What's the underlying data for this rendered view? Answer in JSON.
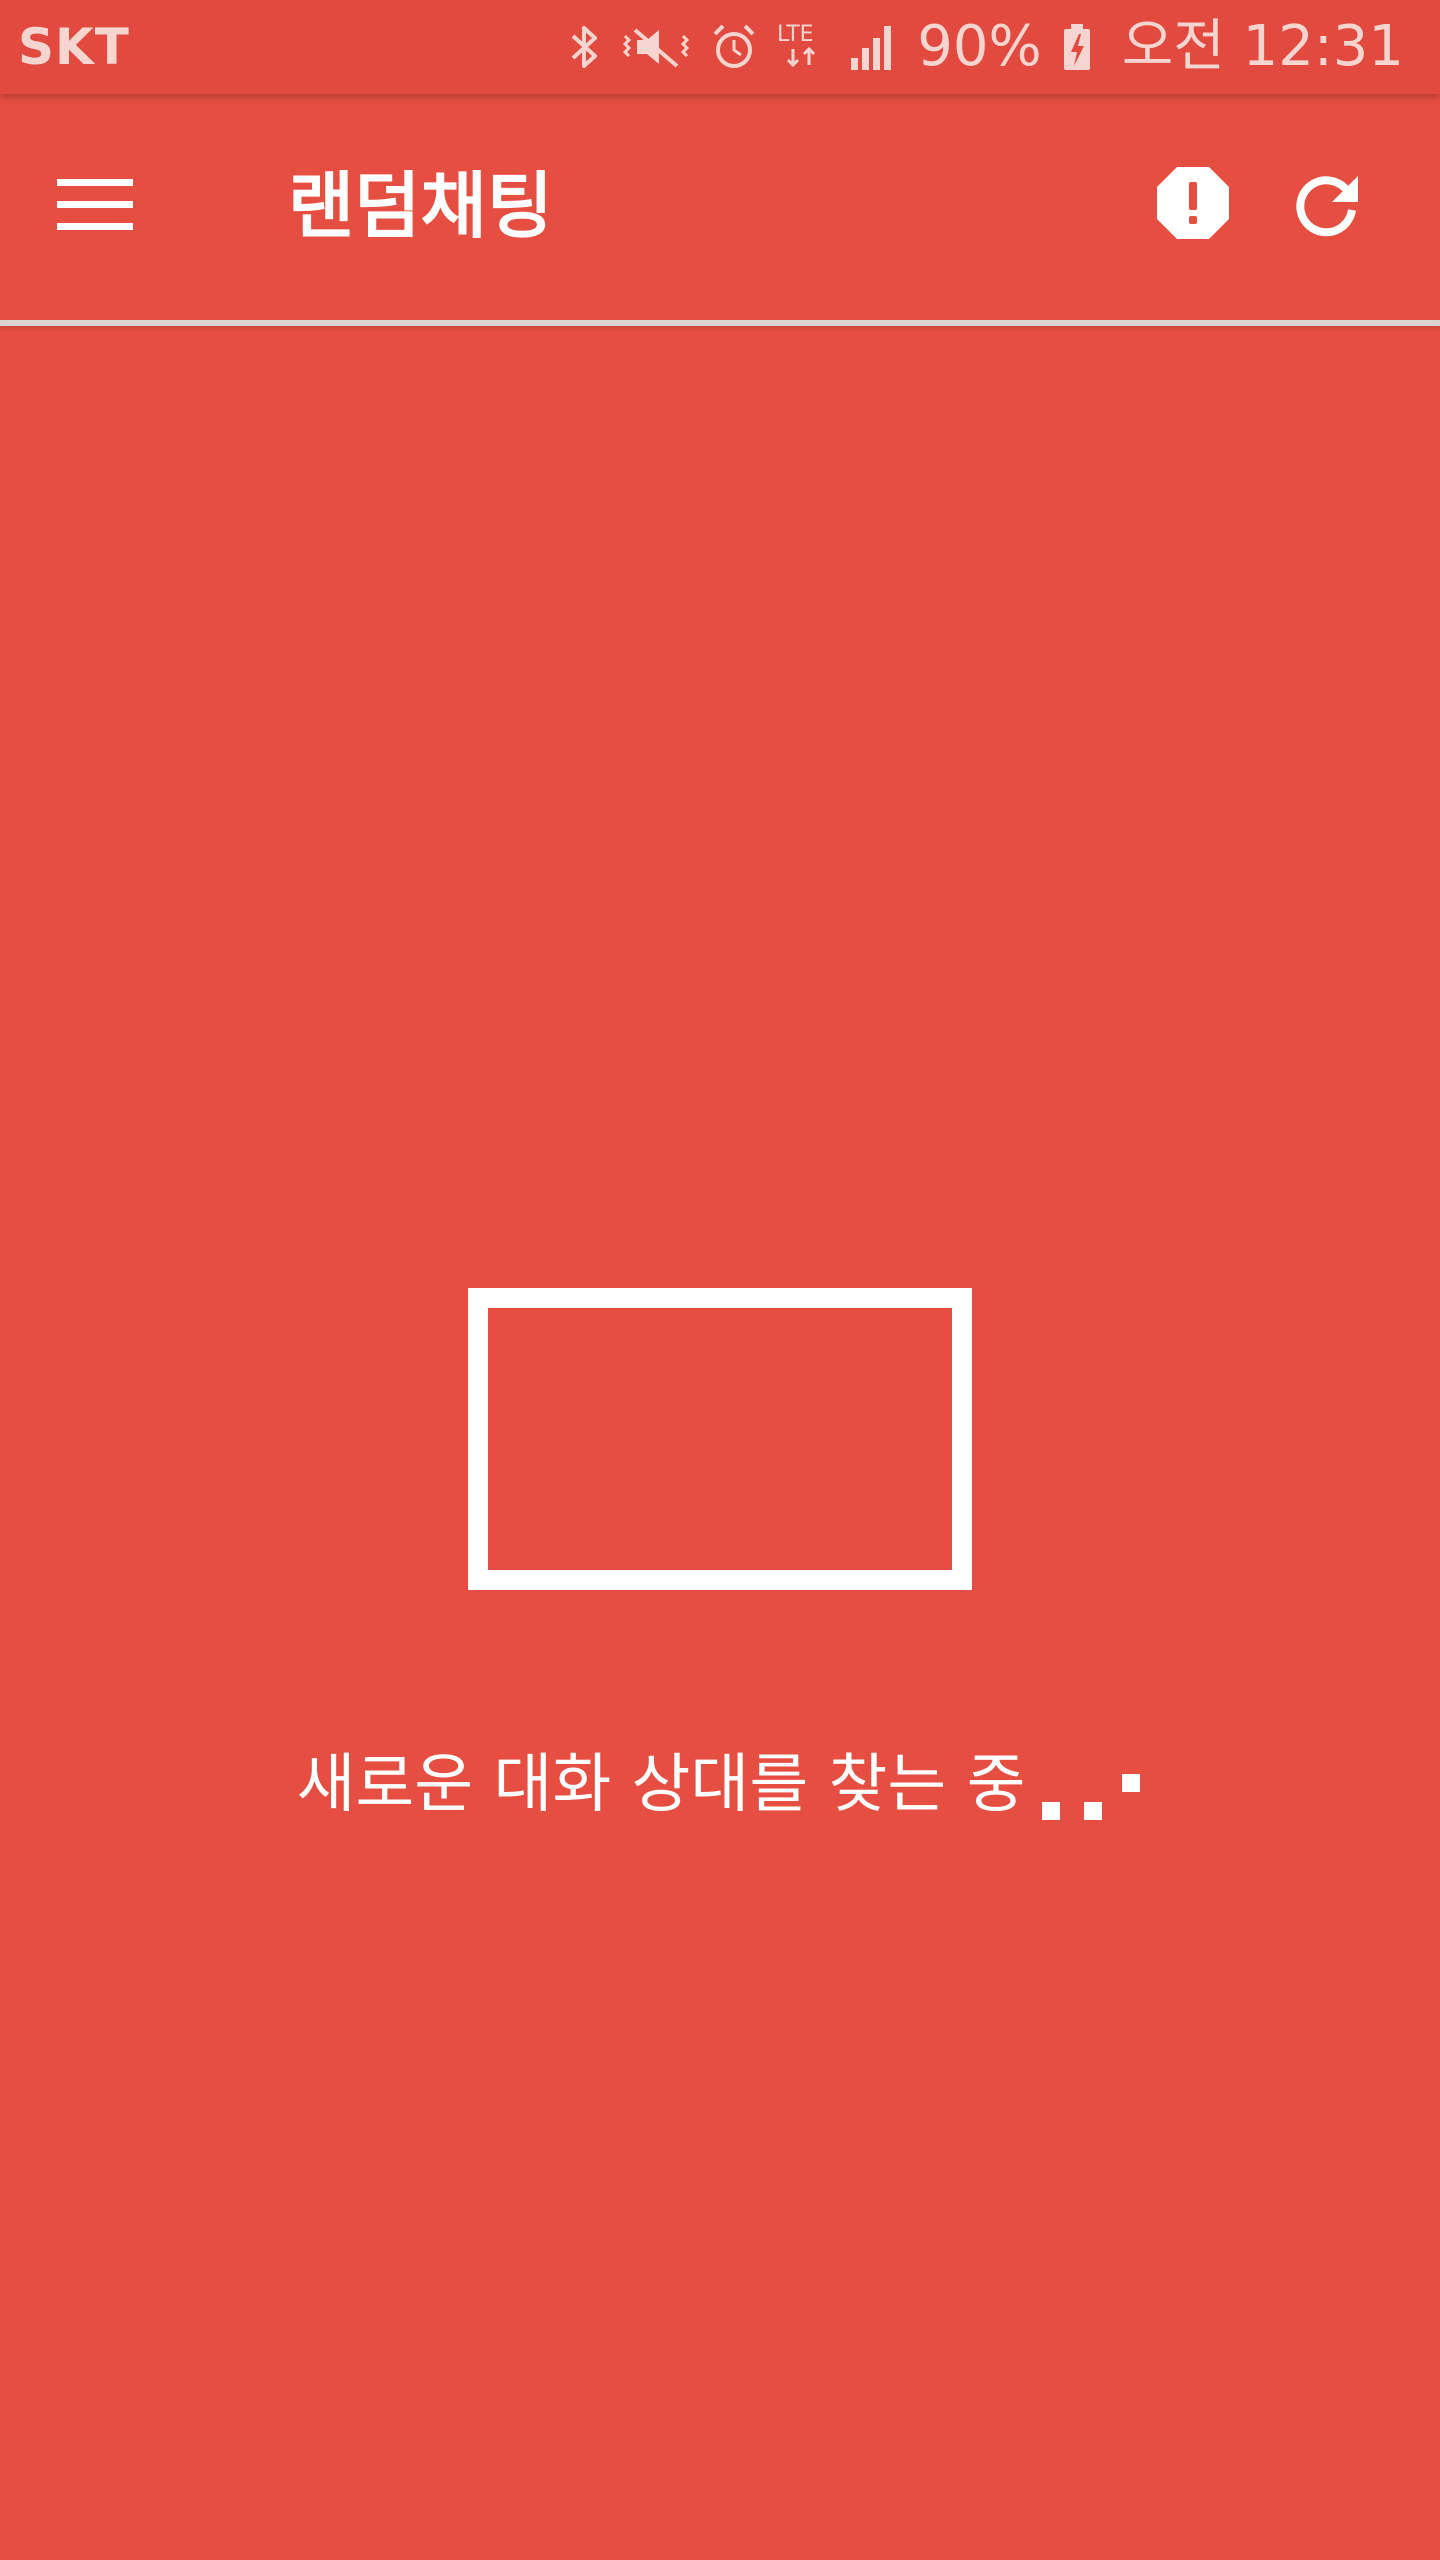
{
  "status_bar": {
    "carrier": "SKT",
    "icons": [
      "bluetooth-icon",
      "vibrate-mute-icon",
      "alarm-icon",
      "lte-icon",
      "signal-icon",
      "battery-charging-icon"
    ],
    "network_label": "LTE",
    "battery_percent": "90%",
    "time": "오전 12:31"
  },
  "app_bar": {
    "menu_icon": "hamburger-menu-icon",
    "title": "랜덤채팅",
    "actions": [
      {
        "icon": "report-alert-icon"
      },
      {
        "icon": "refresh-icon"
      }
    ]
  },
  "main": {
    "status_message": "새로운 대화 상대를 찾는 중"
  },
  "colors": {
    "background": "#E64E42",
    "status_bar": "#E24A3F",
    "foreground": "#FFFFFF"
  }
}
